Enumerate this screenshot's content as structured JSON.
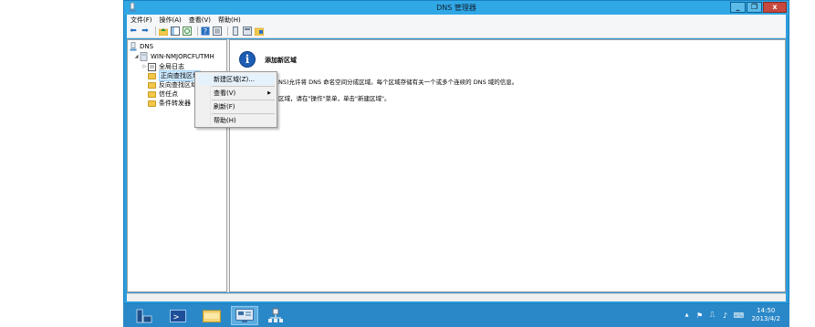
{
  "window": {
    "title": "DNS 管理器",
    "minimize_glyph": "_",
    "restore_glyph": "❐",
    "close_glyph": "x"
  },
  "menu": {
    "items": [
      "文件(F)",
      "操作(A)",
      "查看(V)",
      "帮助(H)"
    ]
  },
  "toolbar": {
    "buttons": [
      "back-icon",
      "forward-icon",
      "up-icon",
      "show-tree-icon",
      "refresh-icon",
      "help-icon",
      "properties-icon",
      "server-icon",
      "list-icon",
      "folder-icon"
    ]
  },
  "tree": {
    "root": "DNS",
    "server": "WIN-NMJORCFUTMH",
    "children": [
      "全局日志",
      "正向查找区域",
      "反向查找区域",
      "信任点",
      "条件转发器"
    ]
  },
  "content": {
    "title": "添加新区域",
    "line1": "NS)允许将 DNS 命名空间分成区域。每个区域存储有关一个或多个连续的 DNS 域的信息。",
    "line2": "区域，请在\"操作\"菜单，单击\"新建区域\"。"
  },
  "context_menu": {
    "items": [
      "新建区域(Z)...",
      "查看(V)",
      "刷新(F)",
      "帮助(H)"
    ]
  },
  "taskbar": {
    "apps": [
      "server-manager-icon",
      "powershell-icon",
      "file-explorer-icon",
      "control-panel-icon",
      "network-icon"
    ],
    "time": "14:50",
    "date": "2013/4/2",
    "tray_arrow": "▲"
  },
  "colors": {
    "titlebar": "#31a8e6",
    "taskbar": "#2b88c8",
    "close_button": "#c7483d",
    "folder": "#f2c84b"
  }
}
